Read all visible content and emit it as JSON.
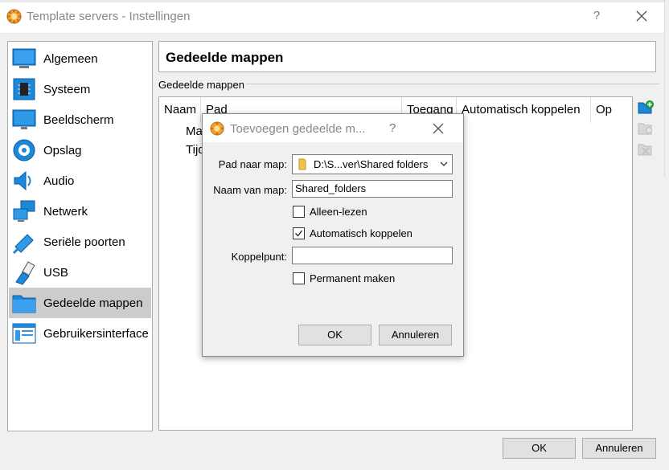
{
  "window": {
    "title": "Template servers - Instellingen",
    "help_glyph": "?"
  },
  "sidebar": {
    "items": [
      {
        "label": "Algemeen",
        "icon": "general-icon"
      },
      {
        "label": "Systeem",
        "icon": "chip-icon"
      },
      {
        "label": "Beeldscherm",
        "icon": "monitor-icon"
      },
      {
        "label": "Opslag",
        "icon": "disk-icon"
      },
      {
        "label": "Audio",
        "icon": "speaker-icon"
      },
      {
        "label": "Netwerk",
        "icon": "network-icon"
      },
      {
        "label": "Seriële poorten",
        "icon": "serial-icon"
      },
      {
        "label": "USB",
        "icon": "usb-icon"
      },
      {
        "label": "Gedeelde mappen",
        "icon": "folder-icon",
        "selected": true
      },
      {
        "label": "Gebruikersinterface",
        "icon": "ui-icon"
      }
    ]
  },
  "main": {
    "header_title": "Gedeelde mappen",
    "section_label": "Gedeelde mappen",
    "table": {
      "columns": [
        "Naam",
        "Pad",
        "Toegang",
        "Automatisch koppelen",
        "Op"
      ],
      "rows": [
        "Ma",
        "Tijd"
      ]
    }
  },
  "footer": {
    "ok_label": "OK",
    "cancel_label": "Annuleren"
  },
  "dialog": {
    "title": "Toevoegen gedeelde m...",
    "help_glyph": "?",
    "path_label": "Pad naar map:",
    "path_value": "D:\\S...ver\\Shared folders",
    "name_label": "Naam van map:",
    "name_value": "Shared_folders",
    "readonly_label": "Alleen-lezen",
    "readonly_checked": false,
    "automount_label": "Automatisch koppelen",
    "automount_checked": true,
    "mountpoint_label": "Koppelpunt:",
    "mountpoint_value": "",
    "permanent_label": "Permanent maken",
    "permanent_checked": false,
    "ok_label": "OK",
    "cancel_label": "Annuleren"
  },
  "colors": {
    "selection": "#cccccc",
    "accent_blue": "#1e88d8",
    "sun_orange": "#f0a020"
  }
}
